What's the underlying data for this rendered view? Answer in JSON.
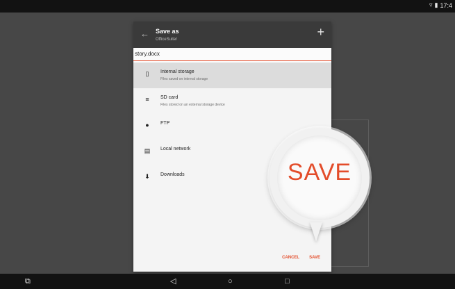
{
  "status_bar": {
    "time": "17:4"
  },
  "dialog": {
    "title": "Save as",
    "path": "OfficeSuite/",
    "filename": "story.docx",
    "locations": [
      {
        "label": "Internal storage",
        "description": "Files saved on internal storage",
        "icon": "phone-icon"
      },
      {
        "label": "SD card",
        "description": "Files stored on an external storage device",
        "icon": "sd-card-icon"
      },
      {
        "label": "FTP",
        "description": "",
        "icon": "globe-icon"
      },
      {
        "label": "Local network",
        "description": "",
        "icon": "server-icon"
      },
      {
        "label": "Downloads",
        "description": "",
        "icon": "download-icon"
      }
    ],
    "cancel_label": "CANCEL",
    "save_label": "SAVE"
  },
  "callout": {
    "text": "SAVE"
  },
  "colors": {
    "accent": "#e34c2a",
    "header": "#3a3a3a"
  }
}
